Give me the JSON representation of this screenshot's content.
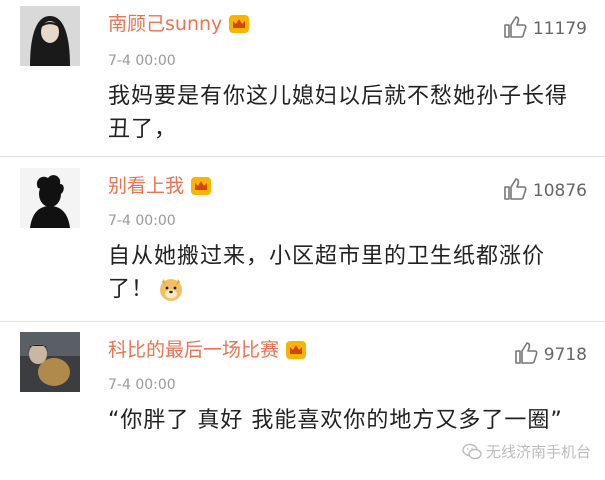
{
  "comments": [
    {
      "username": "南顾己sunny",
      "time": "7-4 00:00",
      "text": "我妈要是有你这儿媳妇以后就不愁她孙子长得丑了，",
      "likes": "11179",
      "avatar": "portrait-avatar"
    },
    {
      "username": "别看上我",
      "time": "7-4 00:00",
      "text": "自从她搬过来，小区超市里的卫生纸都涨价了！",
      "likes": "10876",
      "avatar": "silhouette-avatar"
    },
    {
      "username": "科比的最后一场比赛",
      "time": "7-4 00:00",
      "text": "“你胖了 真好 我能喜欢你的地方又多了一圈”",
      "likes": "9718",
      "avatar": "photo-avatar"
    }
  ],
  "watermark": "无线济南手机台",
  "colors": {
    "username": "#eb7350",
    "time": "#9a9a9a",
    "text": "#222222",
    "crown": "#f7b500"
  }
}
